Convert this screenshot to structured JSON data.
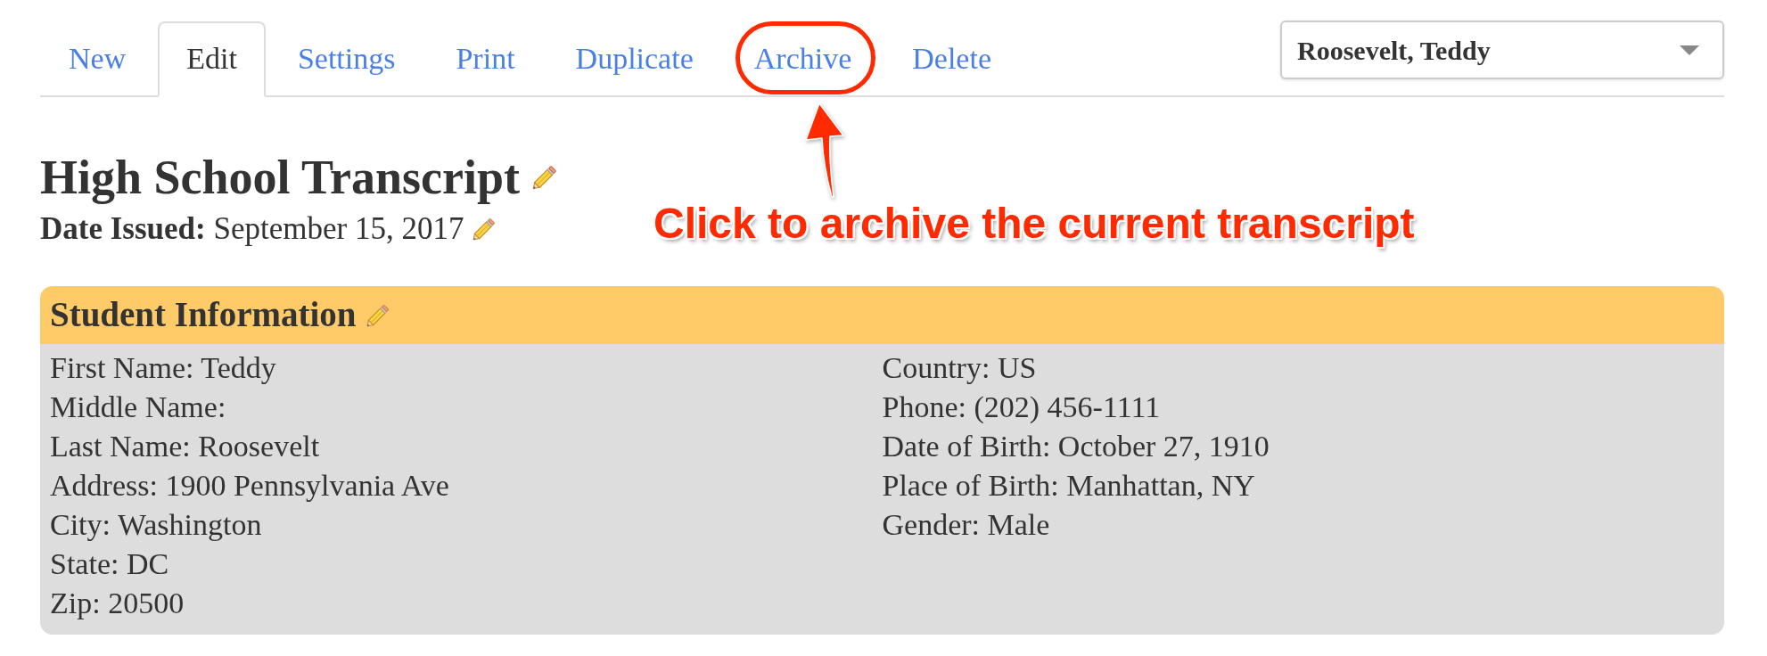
{
  "tabs": [
    {
      "label": "New",
      "selected": false,
      "circled": false
    },
    {
      "label": "Edit",
      "selected": true,
      "circled": false
    },
    {
      "label": "Settings",
      "selected": false,
      "circled": false
    },
    {
      "label": "Print",
      "selected": false,
      "circled": false
    },
    {
      "label": "Duplicate",
      "selected": false,
      "circled": false
    },
    {
      "label": "Archive",
      "selected": false,
      "circled": true
    },
    {
      "label": "Delete",
      "selected": false,
      "circled": false
    }
  ],
  "student_dropdown": {
    "value": "Roosevelt, Teddy"
  },
  "title": "High School Transcript",
  "date_issued": "**Date Issued:** September 15, 2017",
  "callout": {
    "text": "Click to archive the current transcript"
  },
  "student_information": {
    "title": "Student Information",
    "columns": [
      [
        "First Name: Teddy",
        "Middle Name:",
        "Last Name: Roosevelt",
        "Address: 1900 Pennsylvania Ave",
        "City: Washington",
        "State: DC",
        "Zip: 20500"
      ],
      [
        "Country: US",
        "Phone: (202) 456-1111",
        "Date of Birth: October 27, 1910",
        "Place of Birth: Manhattan, NY",
        "Gender: Male"
      ]
    ]
  }
}
